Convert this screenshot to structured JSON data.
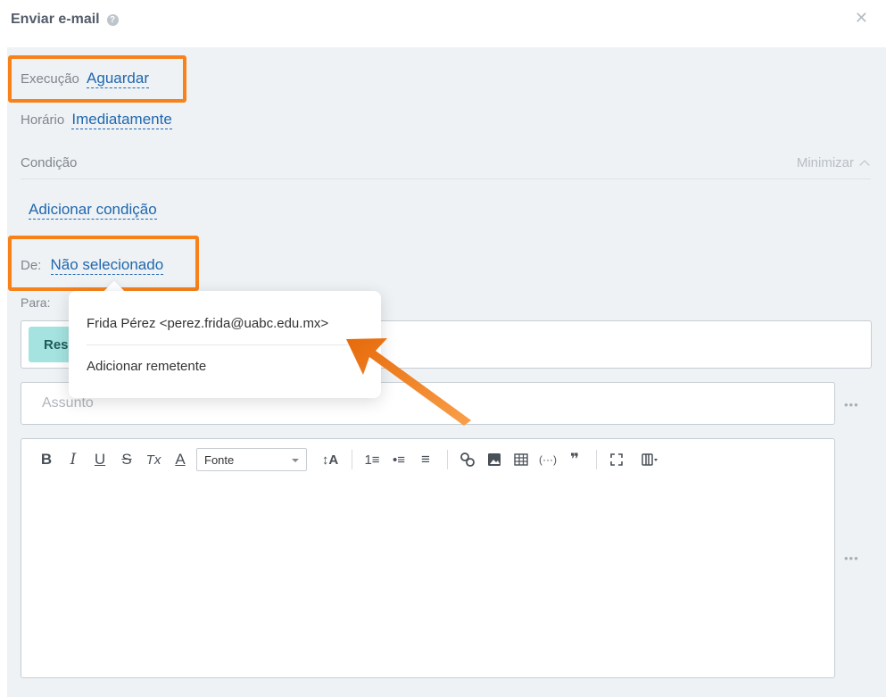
{
  "header": {
    "title": "Enviar e-mail",
    "help_icon": "help-icon",
    "close_icon": "close-icon"
  },
  "execution": {
    "label": "Execução",
    "value": "Aguardar"
  },
  "schedule": {
    "label": "Horário",
    "value": "Imediatamente"
  },
  "condition": {
    "label": "Condição",
    "minimize": "Minimizar",
    "add": "Adicionar condição"
  },
  "from": {
    "label": "De:",
    "value": "Não selecionado"
  },
  "to": {
    "label": "Para:",
    "chip": "Res"
  },
  "subject": {
    "placeholder": "Assunto"
  },
  "dropdown": {
    "items": [
      {
        "label": "Frida Pérez <perez.frida@uabc.edu.mx>"
      },
      {
        "label": "Adicionar remetente"
      }
    ]
  },
  "editor": {
    "toolbar": {
      "bold": "B",
      "italic": "I",
      "underline": "U",
      "strike": "S",
      "clear": "Tx",
      "color": "A",
      "font": "Fonte",
      "font_size": "↕A",
      "ordered": "1≡",
      "bullets": "•≡",
      "align": "≡",
      "link": "link-icon",
      "image": "image-icon",
      "table": "table-icon",
      "code": "(···)",
      "quote": "❞",
      "fullscreen": "fullscreen-icon",
      "source": "source-icon"
    }
  },
  "more": "•••",
  "colors": {
    "accent": "#2067b0",
    "highlight": "#f7821b",
    "chip": "#a5e3e0",
    "panel": "#eef2f4"
  }
}
